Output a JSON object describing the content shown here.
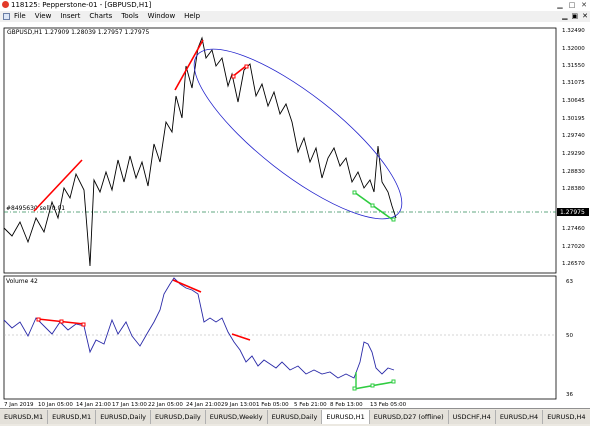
{
  "window": {
    "title": "118125: Pepperstone-01 - [GBPUSD,H1]"
  },
  "menu": [
    "File",
    "View",
    "Insert",
    "Charts",
    "Tools",
    "Window",
    "Help"
  ],
  "chart": {
    "symbol_label": "GBPUSD,H1  1.27909  1.28039  1.27957  1.27975",
    "price_levels": [
      "1.32490",
      "1.32000",
      "1.31550",
      "1.31075",
      "1.30645",
      "1.30195",
      "1.29740",
      "1.29290",
      "1.28830",
      "1.28380",
      "1.27975",
      "1.27460",
      "1.27020",
      "1.26570"
    ],
    "current_price": "1.27975",
    "order_label": "#8495630 sell 0.01",
    "volume_label": "Volume 42",
    "volume_levels": [
      "63",
      "50",
      "36"
    ],
    "time_labels": [
      "7 Jan 2019",
      "10 Jan 05:00",
      "14 Jan 21:00",
      "17 Jan 13:00",
      "22 Jan 05:00",
      "24 Jan 21:00",
      "29 Jan 13:00",
      "1 Feb 05:00",
      "5 Feb 21:00",
      "8 Feb 13:00",
      "13 Feb 05:00"
    ]
  },
  "tabs": [
    "EURUSD,M1",
    "EURUSD,M1",
    "EURUSD,Daily",
    "EURUSD,Daily",
    "EURUSD,Weekly",
    "EURUSD,Daily",
    "EURUSD,H1",
    "EURUSD,D27 (offline)",
    "USDCHF,H4",
    "EURUSD,H4",
    "EURUSD,H4"
  ],
  "active_tab_index": 6,
  "colors": {
    "price_line": "#000000",
    "volume_line": "#2a2aa8",
    "up_mark": "#ff0000",
    "down_mark": "#2ecc40",
    "channel": "#2222cc",
    "level_line": "#2e8b57"
  }
}
